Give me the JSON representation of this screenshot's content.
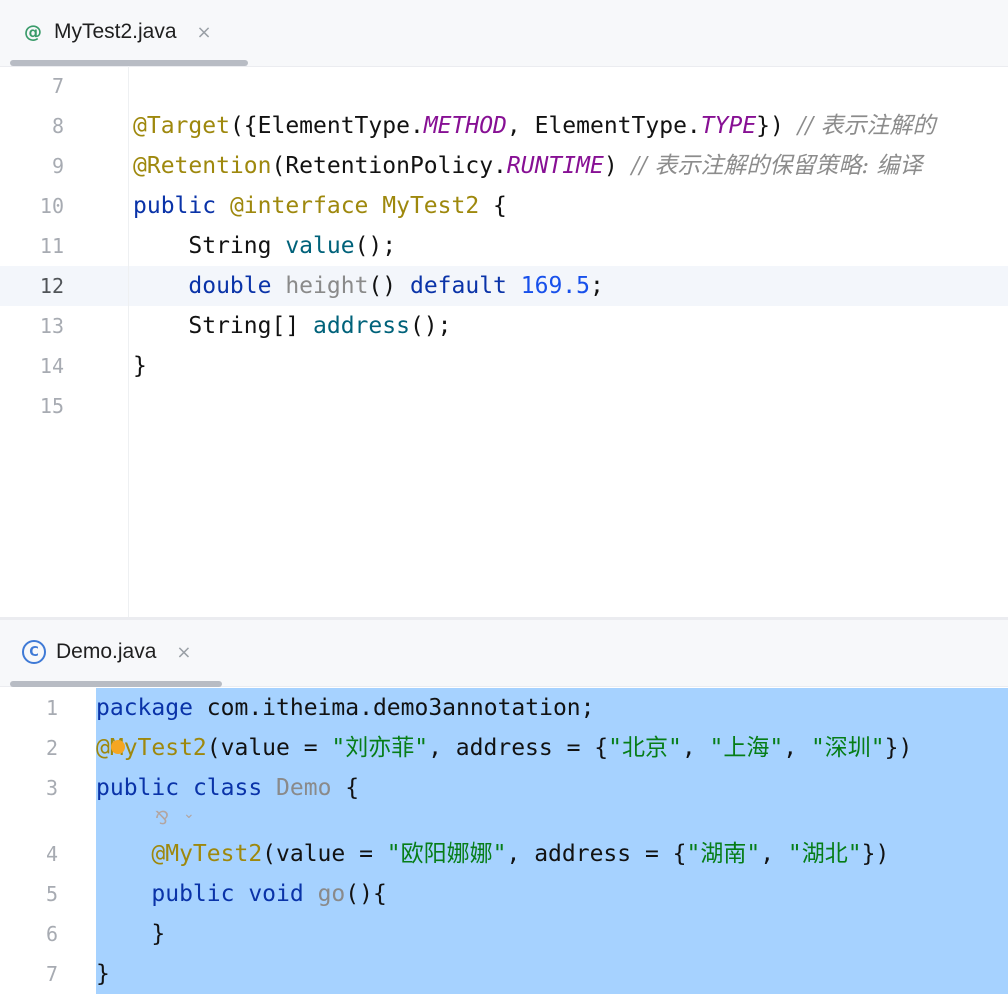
{
  "top_editor": {
    "tab": {
      "icon": "annotation-icon",
      "label": "MyTest2.java",
      "close": "×"
    },
    "lines": [
      {
        "num": "7"
      },
      {
        "num": "8",
        "parts": [
          {
            "t": "@Target",
            "c": "ann"
          },
          {
            "t": "({ElementType.",
            "c": ""
          },
          {
            "t": "METHOD",
            "c": "const"
          },
          {
            "t": ", ElementType.",
            "c": ""
          },
          {
            "t": "TYPE",
            "c": "const"
          },
          {
            "t": "}) ",
            "c": ""
          },
          {
            "t": "// 表示注解的",
            "c": "cmt"
          }
        ]
      },
      {
        "num": "9",
        "parts": [
          {
            "t": "@Retention",
            "c": "ann"
          },
          {
            "t": "(RetentionPolicy.",
            "c": ""
          },
          {
            "t": "RUNTIME",
            "c": "const"
          },
          {
            "t": ") ",
            "c": ""
          },
          {
            "t": "// 表示注解的保留策略: 编译",
            "c": "cmt"
          }
        ]
      },
      {
        "num": "10",
        "parts": [
          {
            "t": "public ",
            "c": "kw"
          },
          {
            "t": "@interface ",
            "c": "ann"
          },
          {
            "t": "MyTest2",
            "c": "ann"
          },
          {
            "t": " {",
            "c": ""
          }
        ]
      },
      {
        "num": "11",
        "parts": [
          {
            "t": "    String ",
            "c": ""
          },
          {
            "t": "value",
            "c": "meth"
          },
          {
            "t": "();",
            "c": ""
          }
        ]
      },
      {
        "num": "12",
        "active": true,
        "parts": [
          {
            "t": "    ",
            "c": ""
          },
          {
            "t": "double ",
            "c": "kw"
          },
          {
            "t": "height",
            "c": "grey"
          },
          {
            "t": "() ",
            "c": ""
          },
          {
            "t": "default ",
            "c": "kw"
          },
          {
            "t": "169.5",
            "c": "num"
          },
          {
            "t": ";",
            "c": ""
          }
        ]
      },
      {
        "num": "13",
        "parts": [
          {
            "t": "    String[] ",
            "c": ""
          },
          {
            "t": "address",
            "c": "meth"
          },
          {
            "t": "();",
            "c": ""
          }
        ]
      },
      {
        "num": "14",
        "parts": [
          {
            "t": "}",
            "c": ""
          }
        ]
      },
      {
        "num": "15"
      }
    ]
  },
  "bottom_editor": {
    "tab": {
      "icon": "class-icon",
      "label": "Demo.java",
      "close": "×"
    },
    "lines": [
      {
        "num": "1",
        "parts": [
          {
            "t": "package ",
            "c": "kw"
          },
          {
            "t": "com.itheima.demo3annotation;",
            "c": ""
          }
        ]
      },
      {
        "num": "2",
        "parts": [
          {
            "t": "@MyTest2",
            "c": "ann"
          },
          {
            "t": "(value = ",
            "c": ""
          },
          {
            "t": "\"刘亦菲\"",
            "c": "str"
          },
          {
            "t": ", address = {",
            "c": ""
          },
          {
            "t": "\"北京\"",
            "c": "str"
          },
          {
            "t": ", ",
            "c": ""
          },
          {
            "t": "\"上海\"",
            "c": "str"
          },
          {
            "t": ", ",
            "c": ""
          },
          {
            "t": "\"深圳\"",
            "c": "str"
          },
          {
            "t": "})",
            "c": ""
          }
        ]
      },
      {
        "num": "3",
        "parts": [
          {
            "t": "public ",
            "c": "kw"
          },
          {
            "t": "class ",
            "c": "kw"
          },
          {
            "t": "Demo",
            "c": "grey"
          },
          {
            "t": " {",
            "c": ""
          }
        ]
      },
      {
        "num": "4",
        "parts": [
          {
            "t": "    ",
            "c": ""
          },
          {
            "t": "@MyTest2",
            "c": "ann"
          },
          {
            "t": "(value = ",
            "c": ""
          },
          {
            "t": "\"欧阳娜娜\"",
            "c": "str"
          },
          {
            "t": ", address = {",
            "c": ""
          },
          {
            "t": "\"湖南\"",
            "c": "str"
          },
          {
            "t": ", ",
            "c": ""
          },
          {
            "t": "\"湖北\"",
            "c": "str"
          },
          {
            "t": "})",
            "c": ""
          }
        ]
      },
      {
        "num": "5",
        "parts": [
          {
            "t": "    ",
            "c": ""
          },
          {
            "t": "public ",
            "c": "kw"
          },
          {
            "t": "void ",
            "c": "kw"
          },
          {
            "t": "go",
            "c": "grey"
          },
          {
            "t": "(){",
            "c": ""
          }
        ]
      },
      {
        "num": "6",
        "parts": [
          {
            "t": "    }",
            "c": ""
          }
        ]
      },
      {
        "num": "7",
        "parts": [
          {
            "t": "}",
            "c": ""
          }
        ]
      }
    ],
    "inlay_hint": {
      "icon": "author-hint-icon",
      "glyph": "⅋",
      "chevron": "⌄"
    }
  },
  "colors": {
    "selection": "#a6d2ff",
    "keyword": "#0a33a8",
    "annotation": "#9e880d",
    "string": "#067d17",
    "number": "#1750eb",
    "constant": "#871094",
    "comment": "#8c8c8c"
  }
}
